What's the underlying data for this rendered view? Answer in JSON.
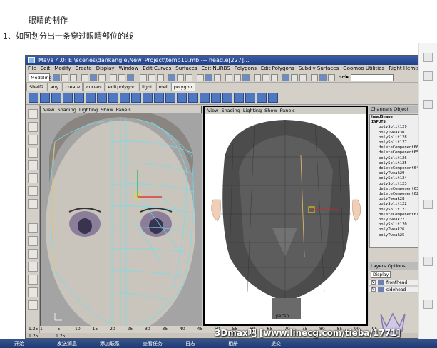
{
  "caption": {
    "line1": "眼睛的制作",
    "line2": "1、如图划分出一条穿过眼睛部位的线"
  },
  "window": {
    "title": "Maya 4.0: E:\\scenes\\dankangle\\New_Project\\temp10.mb  ---  head.e[227]..."
  },
  "menubar": [
    "File",
    "Edit",
    "Modify",
    "Create",
    "Display",
    "Window",
    "Edit Curves",
    "Surfaces",
    "Edit NURBS",
    "Polygons",
    "Edit Polygons",
    "Subdiv Surfaces",
    "Goomoo Utilities",
    "Right Hemisphere",
    "Help"
  ],
  "toolbar": {
    "mode": "Modeling",
    "so_label": "sel▸"
  },
  "shelf_tabs": [
    "Shelf2",
    "any",
    "create",
    "curves",
    "editpolygon",
    "light",
    "mel",
    "polygon"
  ],
  "panel_left": {
    "menus": [
      "View",
      "Shading",
      "Lighting",
      "Show",
      "Panels"
    ]
  },
  "panel_right": {
    "menus": [
      "View",
      "Shading",
      "Lighting",
      "Show",
      "Panels"
    ],
    "camera": "persp"
  },
  "channel_box": {
    "tabs": "Channels  Object",
    "object": "headShape",
    "inputs_label": "INPUTS",
    "items": [
      "polySplit129",
      "polyTweak30",
      "polySplit128",
      "polySplit127",
      "deleteComponent66",
      "deleteComponent65",
      "polySplit126",
      "polySplit125",
      "deleteComponent64",
      "polyTweak29",
      "polySplit124",
      "polySplit123",
      "deleteComponent63",
      "deleteComponent62",
      "polyTweak28",
      "polySplit122",
      "polySplit121",
      "deleteComponent61",
      "polyTweak27",
      "polySplit120",
      "polyTweak26",
      "polyTweak25"
    ]
  },
  "layers": {
    "header": "Layers  Options",
    "display": "Display",
    "rows": [
      {
        "vis": "V",
        "name": "fronthead"
      },
      {
        "vis": "V",
        "name": "sidehead"
      }
    ]
  },
  "timeline": {
    "ticks": [
      "1",
      "5",
      "10",
      "15",
      "20",
      "25",
      "30",
      "35",
      "40",
      "45",
      "50",
      "55",
      "60",
      "65",
      "70",
      "75",
      "80",
      "85",
      "90",
      "95",
      "100"
    ],
    "start": "1.25",
    "range_start": "1.25",
    "range_end": "1.25"
  },
  "watermark": "3Dmax吧  [www.linecg.com/tieba/1771]",
  "taskbar": [
    "开始",
    "发送消息",
    "添加联系",
    "查看任务",
    "日志",
    "相册",
    "提交"
  ],
  "colors": {
    "wire": "#6fe0f0",
    "mesh_dark": "#4c4c4c",
    "skin": "#f1cfb6",
    "title": "#2c4c99"
  }
}
